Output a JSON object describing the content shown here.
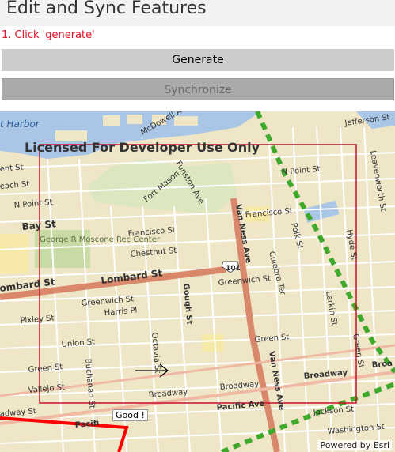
{
  "app": {
    "title": "Edit and Sync Features"
  },
  "instruction": {
    "text": "1. Click 'generate'"
  },
  "toolbar": {
    "generate_label": "Generate",
    "synchronize_label": "Synchronize"
  },
  "map": {
    "watermark": "Licensed For Developer Use Only",
    "attribution": "Powered by Esri",
    "popup": "Good !",
    "labels": {
      "harbor": "t Harbor",
      "mcdowell": "McDowell Ave",
      "jefferson": "Jefferson St",
      "funston": "Funston Ave",
      "npoint1": "N Point St",
      "npoint2": "N Point St",
      "bay": "Bay St",
      "fortmason": "Fort Mason",
      "dept": "ent St",
      "each": "each St",
      "georger": "George R Moscone Rec Center",
      "francisco1": "Francisco St",
      "francisco2": "Francisco St",
      "chestnut": "Chestnut St",
      "vanness1": "Van Ness Ave",
      "vanness2": "Van Ness Ave",
      "hwy101": "101",
      "lombard1": "Lombard St",
      "lombard2": "ombard St",
      "greenwich1": "Greenwich St",
      "greenwich2": "Greenwich St",
      "harris": "Harris Pl",
      "gough": "Gough St",
      "pixley": "Pixley St",
      "union": "Union St",
      "green1": "Green St",
      "green2": "Green St",
      "vallejo": "Vallejo St",
      "broadway1": "Broadway",
      "broadway2": "Broadway",
      "broadway3": "Broadway",
      "pacific": "Pacific Ave",
      "pacific2": "Pacifi",
      "jackson": "Jackson St",
      "washington": "Washington St",
      "octavia": "Octavia St",
      "buchanan": "Buchanan St",
      "larkin": "Larkin St",
      "polk": "Polk St",
      "hyde": "Hyde St",
      "leavenworth": "Leavenworth St",
      "gough_label": "Gough St",
      "culebra": "Culebra Ter",
      "bway": "Broa",
      "adway": "adway St",
      "green_st_r": "Green St"
    }
  }
}
